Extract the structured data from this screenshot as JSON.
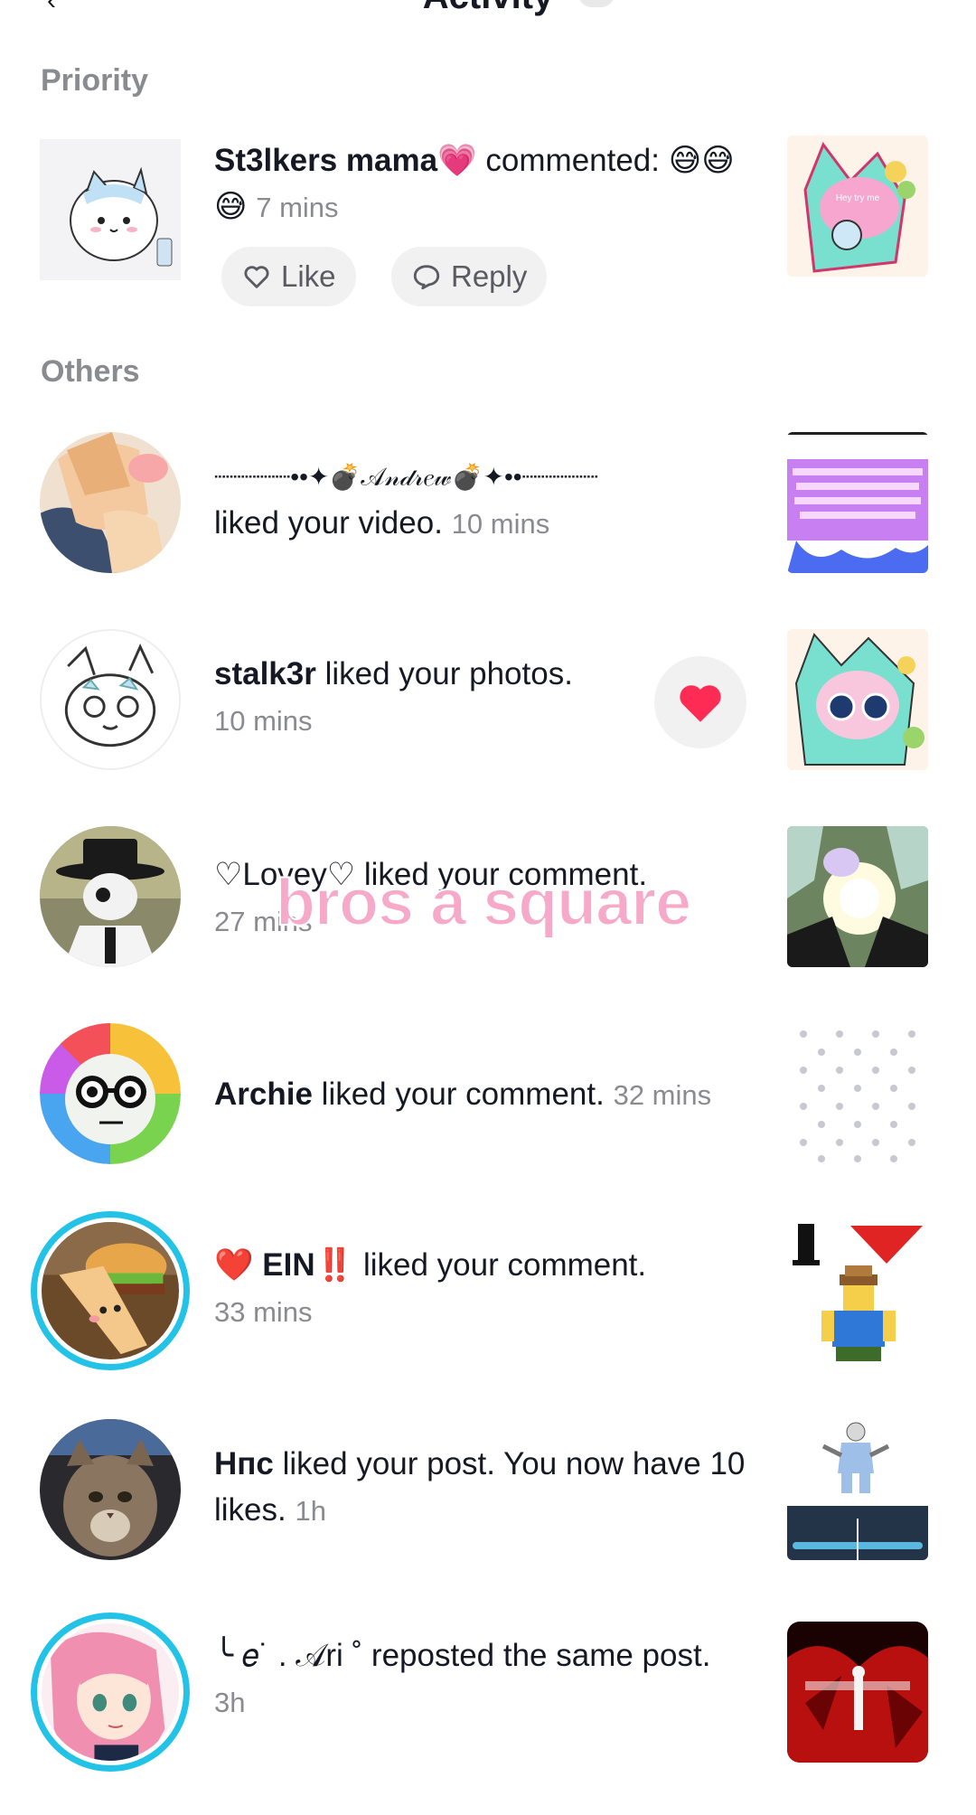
{
  "header": {
    "title": "Activity"
  },
  "sections": {
    "priority": "Priority",
    "others": "Others"
  },
  "priority": {
    "username": "St3lkers mama💗",
    "action": " commented: 😅😅😅",
    "time": "7 mins",
    "like_label": "Like",
    "reply_label": "Reply"
  },
  "items": [
    {
      "username": "┈┈┈┈┈••✦💣𝒜𝓃𝒹𝓇𝑒𝓌💣✦••┈┈┈┈┈",
      "action": "liked your video.",
      "time": "10 mins"
    },
    {
      "username": "stalk3r",
      "action": " liked your photos.",
      "time": "10 mins"
    },
    {
      "username": "♡Lovey♡",
      "action": " liked your comment.",
      "time": "27 mins"
    },
    {
      "username": "Archie",
      "action": " liked your comment.",
      "time": "32 mins"
    },
    {
      "username": "❤️ EIN‼️",
      "action": " liked your comment.",
      "time": "33 mins"
    },
    {
      "username": "Hпс",
      "action": " liked your post. You now have 10 likes.",
      "time": "1h"
    },
    {
      "username": "╰ 𝑒˙ . 𝒜ri ˚",
      "action": " reposted the same post.",
      "time": "3h"
    }
  ],
  "overlay_caption": "bros a square",
  "colors": {
    "accent_ring": "#22c3e6",
    "like_heart": "#fe2c55",
    "secondary_text": "#8a8b91"
  }
}
